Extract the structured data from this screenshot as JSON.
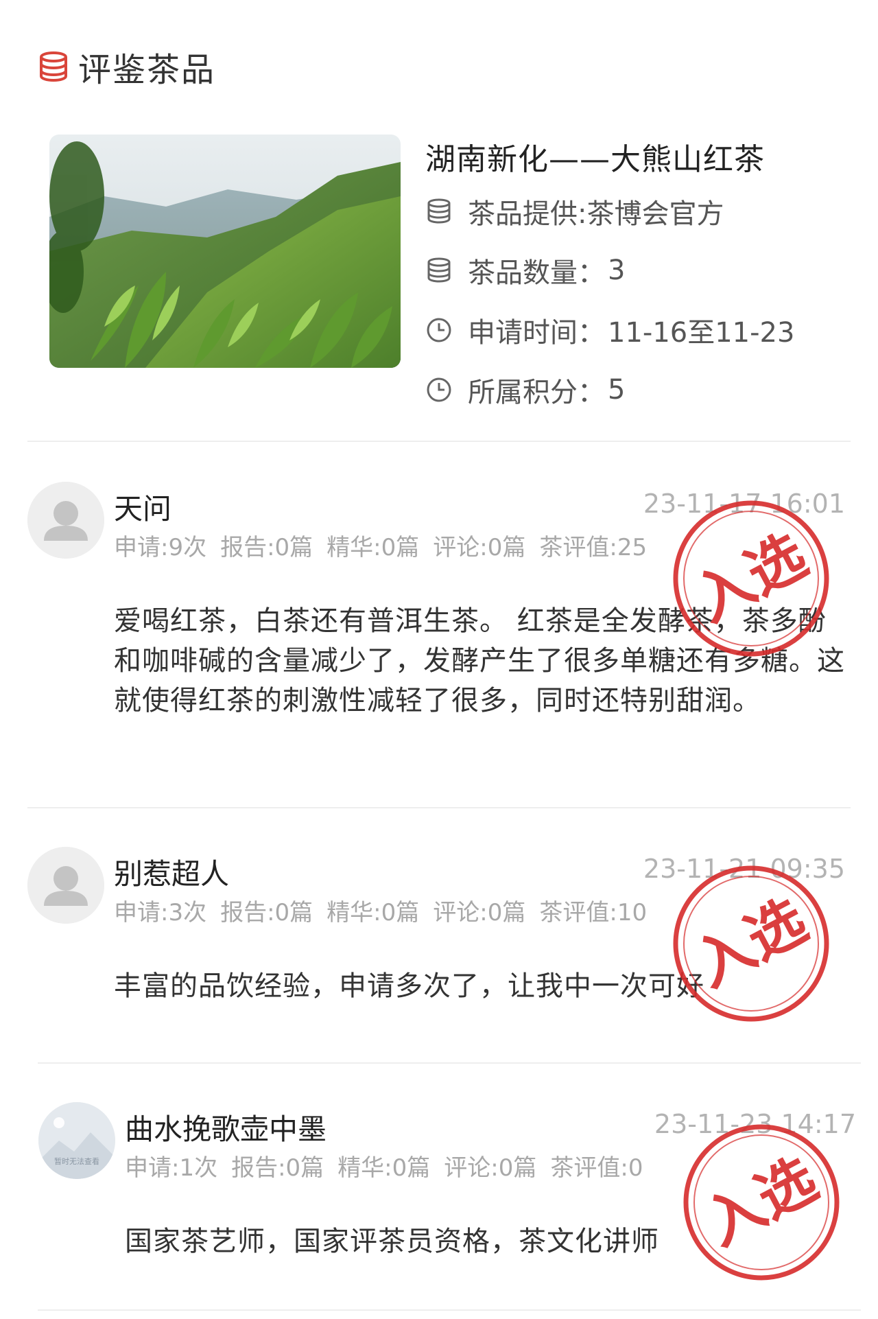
{
  "section": {
    "title": "评鉴茶品",
    "icon": "stack-icon",
    "accent_color": "#d9453a"
  },
  "product": {
    "name": "湖南新化——大熊山红茶",
    "provider": "茶品提供:茶博会官方",
    "quantity_label": "茶品数量：",
    "quantity_value": "3",
    "apply_time_label": "申请时间：",
    "apply_time_value": "11-16至11-23",
    "points_label": "所属积分：",
    "points_value": "5"
  },
  "stamp_text": "入选",
  "stamp_color": "#d62b2b",
  "reviews": [
    {
      "name": "天问",
      "time": "23-11-17 16:01",
      "stats": [
        "申请:9次",
        "报告:0篇",
        "精华:0篇",
        "评论:0篇",
        "茶评值:25"
      ],
      "text": "爱喝红茶，白茶还有普洱生茶。 红茶是全发酵茶，茶多酚和咖啡碱的含量减少了，发酵产生了很多单糖还有多糖。这就使得红茶的刺激性减轻了很多，同时还特别甜润。",
      "selected": true
    },
    {
      "name": "别惹超人",
      "time": "23-11-21 09:35",
      "stats": [
        "申请:3次",
        "报告:0篇",
        "精华:0篇",
        "评论:0篇",
        "茶评值:10"
      ],
      "text": "丰富的品饮经验，申请多次了，让我中一次可好",
      "selected": true
    },
    {
      "name": "曲水挽歌壶中墨",
      "time": "23-11-23 14:17",
      "stats": [
        "申请:1次",
        "报告:0篇",
        "精华:0篇",
        "评论:0篇",
        "茶评值:0"
      ],
      "text": "国家茶艺师，国家评茶员资格，茶文化讲师",
      "selected": true,
      "avatar_placeholder": "暂时无法查看"
    }
  ]
}
